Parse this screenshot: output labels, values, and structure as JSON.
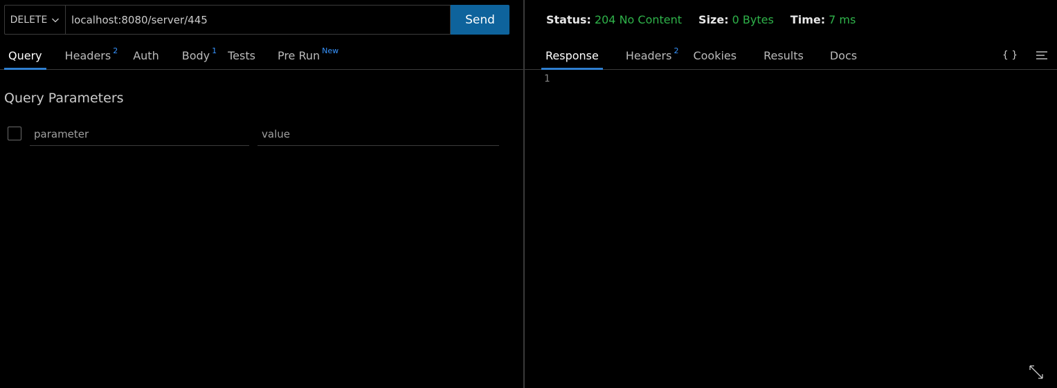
{
  "request": {
    "method": "DELETE",
    "url": "localhost:8080/server/445",
    "send_label": "Send"
  },
  "request_tabs": [
    {
      "label": "Query",
      "badge": ""
    },
    {
      "label": "Headers",
      "badge": "2"
    },
    {
      "label": "Auth",
      "badge": ""
    },
    {
      "label": "Body",
      "badge": "1"
    },
    {
      "label": "Tests",
      "badge": ""
    },
    {
      "label": "Pre Run",
      "badge": "New"
    }
  ],
  "query": {
    "title": "Query Parameters",
    "param_placeholder": "parameter",
    "value_placeholder": "value"
  },
  "response": {
    "status_label": "Status:",
    "status_value": "204 No Content",
    "size_label": "Size:",
    "size_value": "0 Bytes",
    "time_label": "Time:",
    "time_value": "7 ms",
    "line_number": "1"
  },
  "response_tabs": [
    {
      "label": "Response",
      "badge": ""
    },
    {
      "label": "Headers",
      "badge": "2"
    },
    {
      "label": "Cookies",
      "badge": ""
    },
    {
      "label": "Results",
      "badge": ""
    },
    {
      "label": "Docs",
      "badge": ""
    }
  ],
  "icons": {
    "format": "{ }",
    "menu": "menu-lines-icon",
    "expand": "expand-icon"
  },
  "colors": {
    "accent": "#0e639c",
    "tab_underline": "#2f7fd0",
    "badge": "#3794ff",
    "status_ok": "#2fb34a"
  }
}
